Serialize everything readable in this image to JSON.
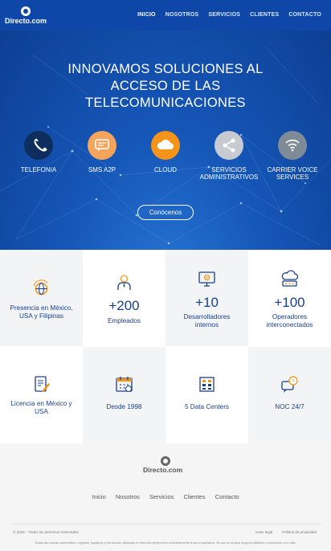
{
  "brand": {
    "name": "Directo.com"
  },
  "nav": {
    "items": [
      "INICIO",
      "NOSOTROS",
      "SERVICIOS",
      "CLIENTES",
      "CONTACTO"
    ],
    "active": "INICIO"
  },
  "hero": {
    "title_lines": [
      "INNOVAMOS SOLUCIONES AL",
      "ACCESO DE LAS",
      "TELECOMUNICACIONES"
    ],
    "cta": "Conócenos"
  },
  "services": [
    {
      "label": "TELEFONIA",
      "icon": "phone-icon",
      "color": "#0e2f5e"
    },
    {
      "label": "SMS A2P",
      "icon": "chat-icon",
      "color": "#f5a45c"
    },
    {
      "label": "CLOUD",
      "icon": "cloud-icon",
      "color": "#f49419"
    },
    {
      "label_lines": [
        "SERVICIOS",
        "ADMINISTRATIVOS"
      ],
      "icon": "share-icon",
      "color": "#c7cbd1"
    },
    {
      "label_lines": [
        "CARRIER VOICE",
        "SERVICES"
      ],
      "icon": "wifi-icon",
      "color": "#7f8b96"
    }
  ],
  "stats_row1": [
    {
      "number": "",
      "text_lines": [
        "Presencia en México,",
        "USA y Filipinas"
      ],
      "icon": "globe-icon"
    },
    {
      "number": "+200",
      "text_lines": [
        "Empleados"
      ],
      "icon": "employee-icon"
    },
    {
      "number": "+10",
      "text_lines": [
        "Desarrolladores",
        "internos"
      ],
      "icon": "monitor-gear-icon"
    },
    {
      "number": "+100",
      "text_lines": [
        "Operadores",
        "interconectados"
      ],
      "icon": "cloud-network-icon"
    }
  ],
  "stats_row2": [
    {
      "text_lines": [
        "Licencia en México y",
        "USA"
      ],
      "icon": "license-document-icon"
    },
    {
      "text_lines": [
        "Desde 1998"
      ],
      "icon": "calendar-icon"
    },
    {
      "text_lines": [
        "5 Data Centers"
      ],
      "icon": "server-icon"
    },
    {
      "text_lines": [
        "NOC 24/7"
      ],
      "icon": "support-chat-icon"
    }
  ],
  "footer": {
    "brand": "Directo.com",
    "links": [
      "Inicio",
      "Nosotros",
      "Servicios",
      "Clientes",
      "Contacto"
    ],
    "copyright": "© 2019 – Todos los derechos reservados",
    "legal_links": [
      "Aviso legal",
      "Política de privacidad"
    ],
    "disclaimer": "Todas las marcas comerciales, registros, logotipos y menciones utilizadas en este sitio pertenecen exclusivamente a sus propietarios. Su uso no implica ninguna afiliación o promoción con ellas."
  },
  "colors": {
    "header": "#0f47a8",
    "text_blue": "#1a3f8a",
    "accent_orange": "#f49419"
  }
}
